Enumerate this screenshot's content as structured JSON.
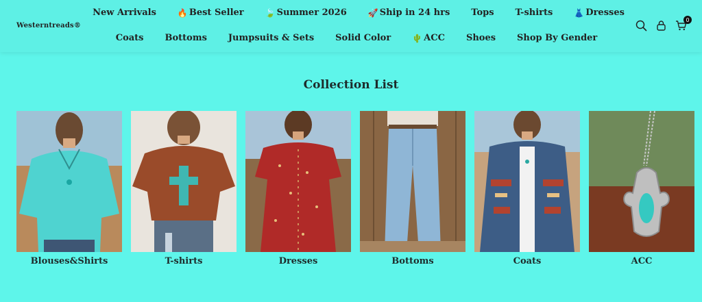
{
  "brand": {
    "name": "Westerntreads®"
  },
  "nav": {
    "row1": [
      {
        "label": "New Arrivals",
        "emoji": ""
      },
      {
        "label": "Best Seller",
        "emoji": "🔥"
      },
      {
        "label": "Summer 2026",
        "emoji": "🍃"
      },
      {
        "label": "Ship in 24 hrs",
        "emoji": "🚀"
      },
      {
        "label": "Tops",
        "emoji": ""
      },
      {
        "label": "T-shirts",
        "emoji": ""
      },
      {
        "label": "Dresses",
        "emoji": "👗"
      }
    ],
    "row2": [
      {
        "label": "Coats",
        "emoji": ""
      },
      {
        "label": "Bottoms",
        "emoji": ""
      },
      {
        "label": "Jumpsuits & Sets",
        "emoji": ""
      },
      {
        "label": "Solid Color",
        "emoji": ""
      },
      {
        "label": "ACC",
        "emoji": "🌵"
      },
      {
        "label": "Shoes",
        "emoji": ""
      },
      {
        "label": "Shop By Gender",
        "emoji": ""
      }
    ]
  },
  "header_icons": {
    "search": "search-icon",
    "account": "user-icon",
    "cart": "cart-icon",
    "cart_count": "0"
  },
  "collection": {
    "title": "Collection List",
    "items": [
      {
        "label": "Blouses&Shirts"
      },
      {
        "label": "T-shirts"
      },
      {
        "label": "Dresses"
      },
      {
        "label": "Bottoms"
      },
      {
        "label": "Coats"
      },
      {
        "label": "ACC"
      }
    ]
  },
  "colors": {
    "background": "#5ef5ea",
    "header": "#5ef0e5",
    "text": "#1d2b2b"
  }
}
